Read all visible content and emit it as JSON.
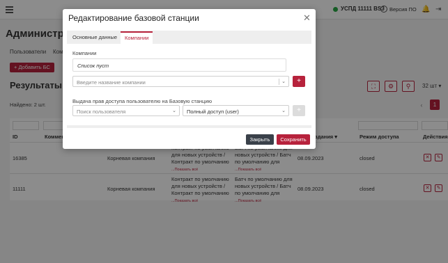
{
  "topbar": {
    "status": "УСПД 11111 BS3",
    "version": "Версия ПО"
  },
  "page": {
    "title": "Администр",
    "subnav": [
      "Пользователи",
      "Ком"
    ],
    "add_button": "+ Добавить БС",
    "results_title": "Результаты по",
    "found": "Найдено: 2 шт.",
    "per_page": "32 шт",
    "current_page": "1"
  },
  "table": {
    "headers": {
      "id": "ID",
      "comment": "Коммен",
      "created": "здания",
      "access_mode": "Режим доступа",
      "actions": "Действия"
    },
    "show_all": "...Показать всё",
    "rows": [
      {
        "id": "16385",
        "company": "Корневая компания",
        "contract": "Контракт по умолчанию для новых устройств / Контракт по умолчанию",
        "batch": "Батч по умолчанию для новых устройств / Батч по умолчанию для",
        "date": "08.09.2023",
        "mode": "closed"
      },
      {
        "id": "11111",
        "company": "Корневая компания",
        "contract": "Контракт по умолчанию для новых устройств / Контракт по умолчанию",
        "batch": "Батч по умолчанию для новых устройств / Батч по умолчанию для",
        "date": "08.09.2023",
        "mode": "closed"
      }
    ]
  },
  "modal": {
    "title": "Редактирование базовой станции",
    "tabs": [
      "Основные данные",
      "Компании"
    ],
    "active_tab": "Компании",
    "companies_label": "Компании",
    "empty_list": "Список пуст",
    "company_placeholder": "Введите название компании",
    "access_label": "Выдача прав доступа пользователю на Базовую станцию",
    "user_placeholder": "Поиск пользователя",
    "access_value": "Полный доступ (user)",
    "close_label": "Закрыть",
    "save_label": "Сохранить"
  },
  "colors": {
    "accent": "#b7223c",
    "dark_button": "#3a414a",
    "status_online": "#27a844"
  }
}
